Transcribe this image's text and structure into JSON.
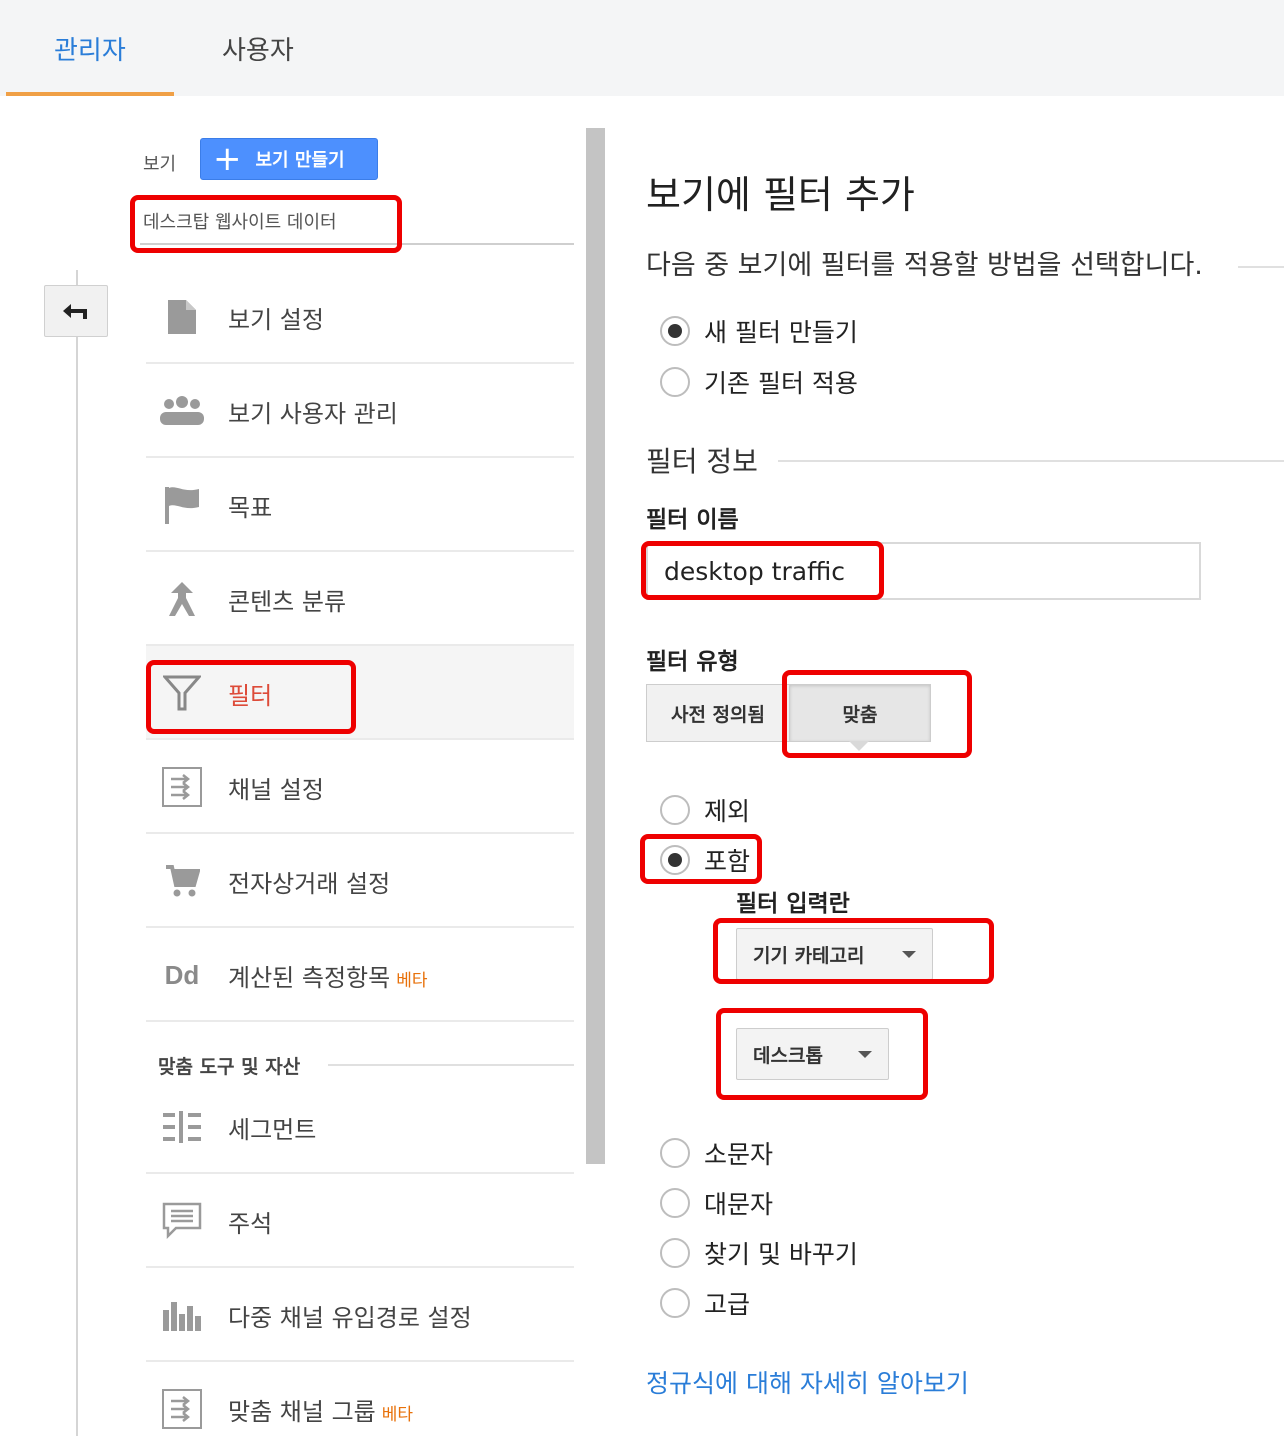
{
  "tabs": {
    "admin": "관리자",
    "user": "사용자"
  },
  "sidebar": {
    "view_label": "보기",
    "create_view_button": "보기 만들기",
    "selected_view": "데스크탑 웹사이트 데이터",
    "items": [
      {
        "label": "보기 설정",
        "icon": "document-icon"
      },
      {
        "label": "보기 사용자 관리",
        "icon": "people-icon"
      },
      {
        "label": "목표",
        "icon": "flag-icon"
      },
      {
        "label": "콘텐츠 분류",
        "icon": "content-grouping-icon"
      },
      {
        "label": "필터",
        "icon": "filter-icon",
        "active": true
      },
      {
        "label": "채널 설정",
        "icon": "channel-settings-icon"
      },
      {
        "label": "전자상거래 설정",
        "icon": "cart-icon"
      },
      {
        "label": "계산된 측정항목",
        "badge": "베타",
        "icon": "dd-icon"
      }
    ],
    "section_heading": "맞춤 도구 및 자산",
    "tool_items": [
      {
        "label": "세그먼트",
        "icon": "segments-icon"
      },
      {
        "label": "주석",
        "icon": "annotation-icon"
      },
      {
        "label": "다중 채널 유입경로 설정",
        "icon": "bar-chart-icon"
      },
      {
        "label": "맞춤 채널 그룹",
        "badge": "베타",
        "icon": "channel-settings-icon"
      }
    ]
  },
  "main": {
    "title": "보기에 필터 추가",
    "subtitle": "다음 중 보기에 필터를 적용할 방법을 선택합니다.",
    "method_options": [
      {
        "label": "새 필터 만들기",
        "checked": true
      },
      {
        "label": "기존 필터 적용",
        "checked": false
      }
    ],
    "filter_info_heading": "필터 정보",
    "filter_name_label": "필터 이름",
    "filter_name_value": "desktop traffic",
    "filter_type_label": "필터 유형",
    "filter_type_buttons": [
      "사전 정의됨",
      "맞춤"
    ],
    "filter_type_selected": "맞춤",
    "custom_options": [
      {
        "label": "제외",
        "checked": false
      },
      {
        "label": "포함",
        "checked": true
      }
    ],
    "filter_field_label": "필터 입력란",
    "filter_field_value": "기기 카테고리",
    "filter_pattern_value": "데스크톱",
    "other_options": [
      {
        "label": "소문자",
        "checked": false
      },
      {
        "label": "대문자",
        "checked": false
      },
      {
        "label": "찾기 및 바꾸기",
        "checked": false
      },
      {
        "label": "고급",
        "checked": false
      }
    ],
    "regex_link": "정규식에 대해 자세히 알아보기"
  },
  "colors": {
    "accent_blue": "#2a7dd8",
    "highlight_red": "#ee0000",
    "tab_underline": "#f0a046",
    "beta_orange": "#e8710a",
    "active_red": "#dd4b39"
  }
}
